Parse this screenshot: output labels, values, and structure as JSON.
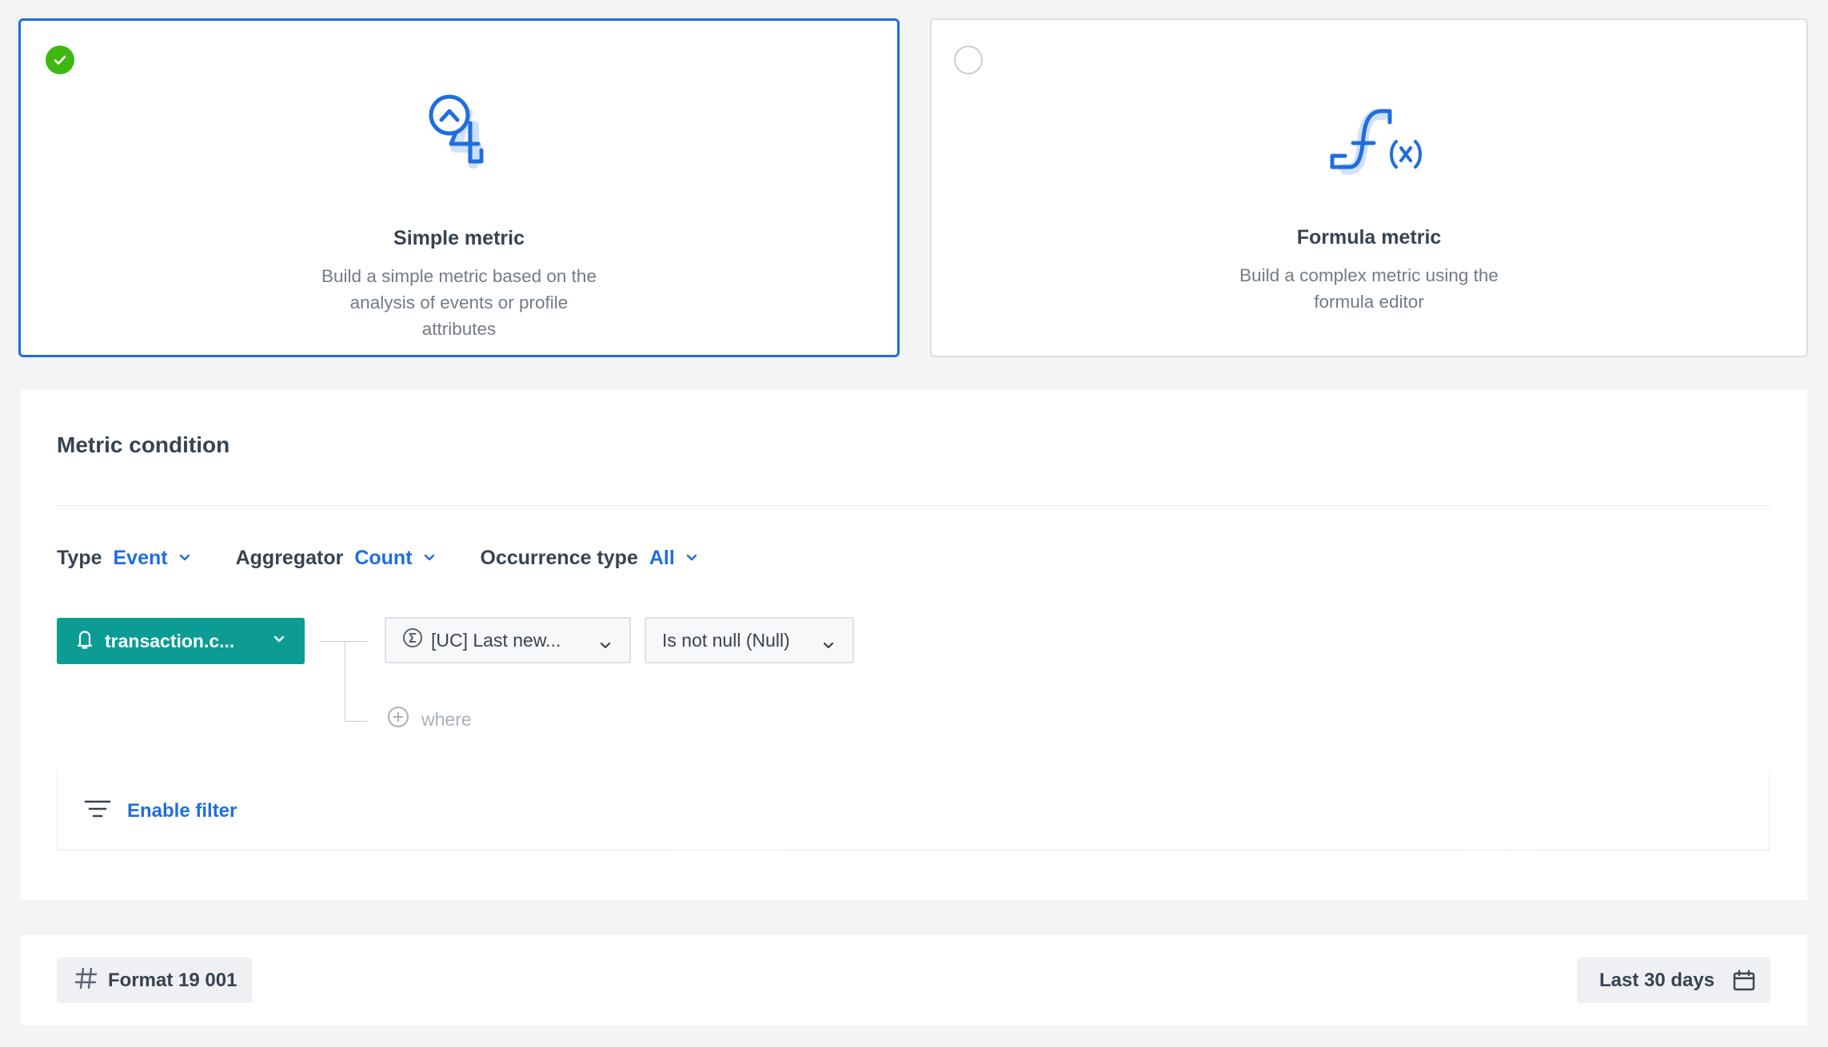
{
  "metric_types": {
    "simple": {
      "title": "Simple metric",
      "description": "Build a simple metric based on the analysis of events or profile attributes",
      "selected": true
    },
    "formula": {
      "title": "Formula metric",
      "description": "Build a complex metric using the formula editor",
      "selected": false
    }
  },
  "condition": {
    "title": "Metric condition",
    "type": {
      "label": "Type",
      "value": "Event"
    },
    "aggregator": {
      "label": "Aggregator",
      "value": "Count"
    },
    "occurrence": {
      "label": "Occurrence type",
      "value": "All"
    },
    "event": {
      "label": "transaction.c...",
      "icon": "bell-icon"
    },
    "parameter": {
      "label": "[UC] Last new...",
      "icon": "sigma-icon"
    },
    "operator": {
      "label": "Is not null (Null)"
    },
    "where_label": "where",
    "filter_label": "Enable filter"
  },
  "footer": {
    "format_label": "Format 19 001",
    "date_label": "Last 30 days"
  },
  "colors": {
    "accent": "#1f6ee0",
    "success": "#3fb812",
    "event_button": "#0c9c94"
  }
}
